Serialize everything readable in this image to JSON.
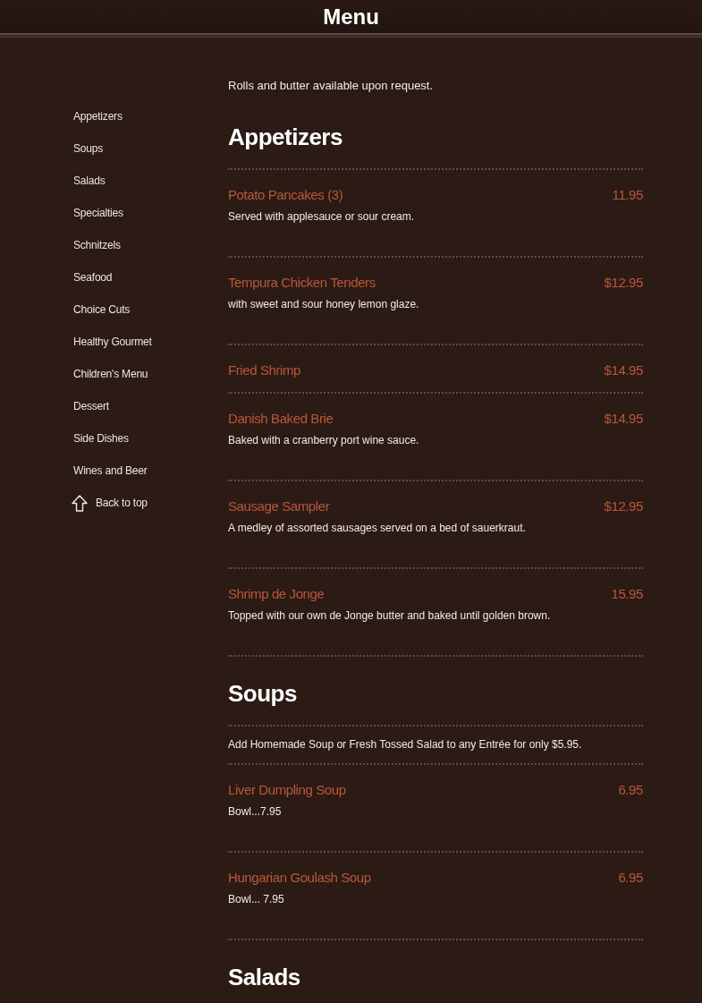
{
  "header": {
    "title": "Menu"
  },
  "sidebar": {
    "items": [
      {
        "label": "Appetizers"
      },
      {
        "label": "Soups"
      },
      {
        "label": "Salads"
      },
      {
        "label": "Specialties"
      },
      {
        "label": "Schnitzels"
      },
      {
        "label": "Seafood"
      },
      {
        "label": "Choice Cuts"
      },
      {
        "label": "Healthy Gourmet"
      },
      {
        "label": "Children's Menu"
      },
      {
        "label": "Dessert"
      },
      {
        "label": "Side Dishes"
      },
      {
        "label": "Wines and Beer"
      }
    ],
    "back_to_top": {
      "label": "Back to top"
    }
  },
  "intro": "Rolls and butter available upon request.",
  "sections": [
    {
      "title": "Appetizers",
      "items": [
        {
          "name": "Potato Pancakes (3)",
          "price": "11.95",
          "description": "Served with applesauce or sour cream."
        },
        {
          "name": "Tempura Chicken Tenders",
          "price": "$12.95",
          "description": "with sweet and sour honey lemon glaze."
        },
        {
          "name": "Fried Shrimp",
          "price": "$14.95"
        },
        {
          "name": "Danish Baked Brie",
          "price": "$14.95",
          "description": "Baked with a cranberry port wine sauce."
        },
        {
          "name": "Sausage Sampler",
          "price": "$12.95",
          "description": "A medley of assorted sausages served on a bed of sauerkraut."
        },
        {
          "name": "Shrimp de Jonge",
          "price": "15.95",
          "description": "Topped with our own de Jonge butter and baked until golden brown."
        }
      ]
    },
    {
      "title": "Soups",
      "note": "Add Homemade Soup or Fresh Tossed Salad to any Entrée for only $5.95.",
      "items": [
        {
          "name": "Liver Dumpling Soup",
          "price": "6.95",
          "description": "Bowl...7.95"
        },
        {
          "name": "Hungarian Goulash Soup",
          "price": "6.95",
          "description": "Bowl... 7.95"
        }
      ]
    },
    {
      "title": "Salads"
    }
  ]
}
